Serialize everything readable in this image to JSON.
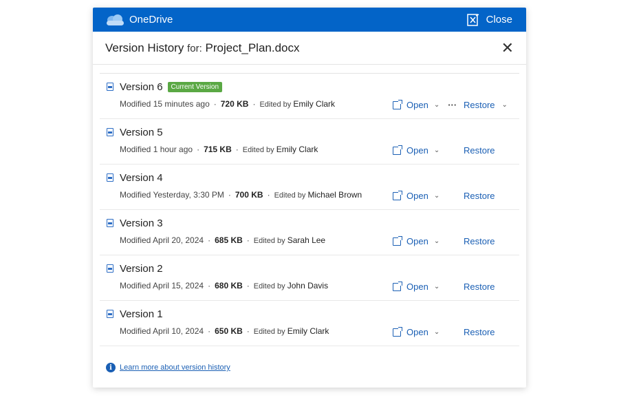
{
  "app": {
    "brand": "OneDrive",
    "close_label": "Close"
  },
  "dialog": {
    "title": "Version History",
    "for_label": "for:",
    "filename": "Project_Plan.docx"
  },
  "versions": [
    {
      "name": "Version 6",
      "badge": "Current Version",
      "modified": "Modified 15 minutes ago",
      "size": "720 KB",
      "edited_prefix": "Edited by",
      "editor": "Emily Clark",
      "open": "Open",
      "restore": "Restore"
    },
    {
      "name": "Version 5",
      "modified": "Modified 1 hour ago",
      "size": "715 KB",
      "edited_prefix": "Edited by",
      "editor": "Emily Clark",
      "open": "Open",
      "restore": "Restore"
    },
    {
      "name": "Version 4",
      "modified": "Modified Yesterday, 3:30 PM",
      "size": "700 KB",
      "edited_prefix": "Edited by",
      "editor": "Michael Brown",
      "open": "Open",
      "restore": "Restore"
    },
    {
      "name": "Version 3",
      "modified": "Modified April 20, 2024",
      "size": "685 KB",
      "edited_prefix": "Edited by",
      "editor": "Sarah Lee",
      "open": "Open",
      "restore": "Restore"
    },
    {
      "name": "Version 2",
      "modified": "Modified April 15, 2024",
      "size": "680 KB",
      "edited_prefix": "Edited by",
      "editor": "John Davis",
      "open": "Open",
      "restore": "Restore"
    },
    {
      "name": "Version 1",
      "modified": "Modified April 10, 2024",
      "size": "650 KB",
      "edited_prefix": "Edited by",
      "editor": "Emily Clark",
      "open": "Open",
      "restore": "Restore"
    }
  ],
  "footer": {
    "link": "Learn more about version history"
  },
  "colors": {
    "brand": "#0364c8",
    "badge": "#5aa844",
    "link": "#1a5fb4"
  }
}
